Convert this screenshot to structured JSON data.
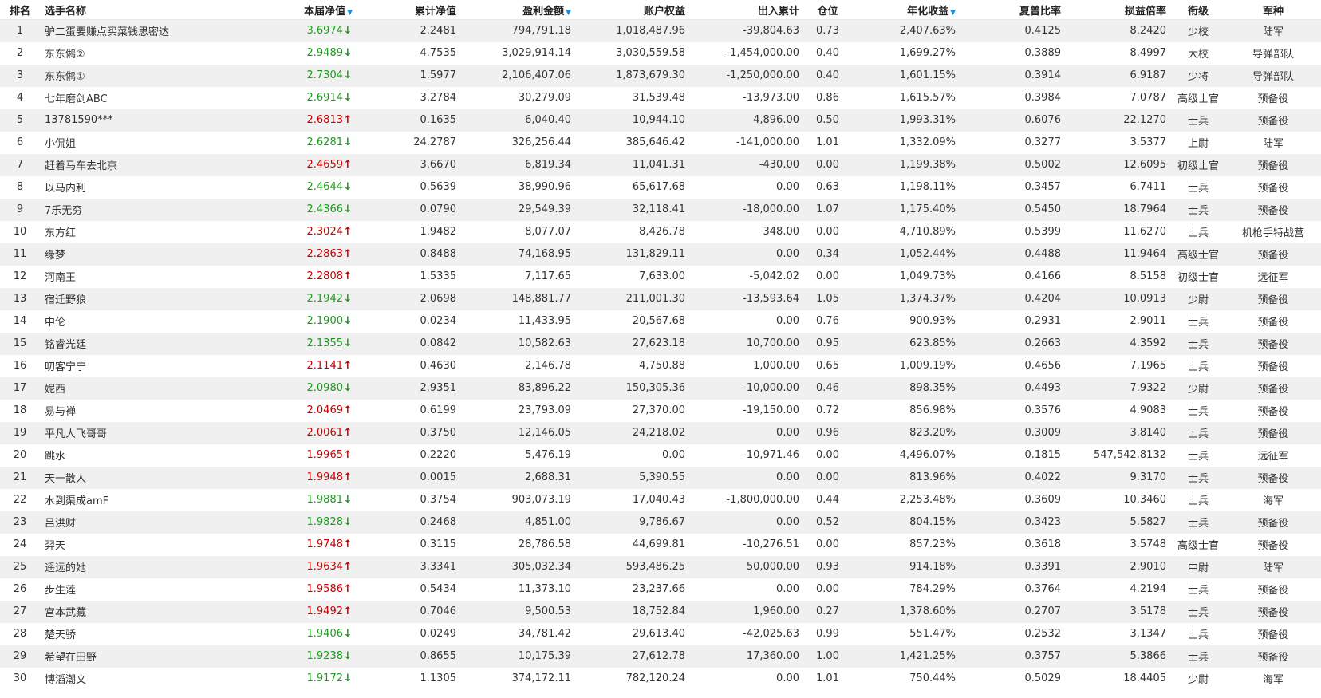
{
  "header": {
    "rank": "排名",
    "name": "选手名称",
    "nav": "本届净值",
    "cum_nav": "累计净值",
    "profit": "盈利金额",
    "equity": "账户权益",
    "flow": "出入累计",
    "position": "仓位",
    "annual": "年化收益",
    "sharpe": "夏普比率",
    "pl_ratio": "损益倍率",
    "rank_title": "衔级",
    "branch": "军种",
    "sort_icon": "▼"
  },
  "colors": {
    "up": "#cc0000",
    "down": "#1a9e1a",
    "sort": "#1a8fd8",
    "stripe": "#f0f0f0"
  },
  "rows": [
    {
      "rank": "1",
      "name": "驴二蛋要赚点买菜钱思密达",
      "nav": "3.6974",
      "dir": "down",
      "cum": "2.2481",
      "profit": "794,791.18",
      "equity": "1,018,487.96",
      "flow": "-39,804.63",
      "pos": "0.73",
      "annual": "2,407.63%",
      "sharpe": "0.4125",
      "plr": "8.2420",
      "title": "少校",
      "branch": "陆军"
    },
    {
      "rank": "2",
      "name": "东东鸺②",
      "nav": "2.9489",
      "dir": "down",
      "cum": "4.7535",
      "profit": "3,029,914.14",
      "equity": "3,030,559.58",
      "flow": "-1,454,000.00",
      "pos": "0.40",
      "annual": "1,699.27%",
      "sharpe": "0.3889",
      "plr": "8.4997",
      "title": "大校",
      "branch": "导弹部队"
    },
    {
      "rank": "3",
      "name": "东东鸺①",
      "nav": "2.7304",
      "dir": "down",
      "cum": "1.5977",
      "profit": "2,106,407.06",
      "equity": "1,873,679.30",
      "flow": "-1,250,000.00",
      "pos": "0.40",
      "annual": "1,601.15%",
      "sharpe": "0.3914",
      "plr": "6.9187",
      "title": "少将",
      "branch": "导弹部队"
    },
    {
      "rank": "4",
      "name": "七年磨剑ABC",
      "nav": "2.6914",
      "dir": "down",
      "cum": "3.2784",
      "profit": "30,279.09",
      "equity": "31,539.48",
      "flow": "-13,973.00",
      "pos": "0.86",
      "annual": "1,615.57%",
      "sharpe": "0.3984",
      "plr": "7.0787",
      "title": "高级士官",
      "branch": "预备役"
    },
    {
      "rank": "5",
      "name": "13781590***",
      "nav": "2.6813",
      "dir": "up",
      "cum": "0.1635",
      "profit": "6,040.40",
      "equity": "10,944.10",
      "flow": "4,896.00",
      "pos": "0.50",
      "annual": "1,993.31%",
      "sharpe": "0.6076",
      "plr": "22.1270",
      "title": "士兵",
      "branch": "预备役"
    },
    {
      "rank": "6",
      "name": "小侃姐",
      "nav": "2.6281",
      "dir": "down",
      "cum": "24.2787",
      "profit": "326,256.44",
      "equity": "385,646.42",
      "flow": "-141,000.00",
      "pos": "1.01",
      "annual": "1,332.09%",
      "sharpe": "0.3277",
      "plr": "3.5377",
      "title": "上尉",
      "branch": "陆军"
    },
    {
      "rank": "7",
      "name": "赶着马车去北京",
      "nav": "2.4659",
      "dir": "up",
      "cum": "3.6670",
      "profit": "6,819.34",
      "equity": "11,041.31",
      "flow": "-430.00",
      "pos": "0.00",
      "annual": "1,199.38%",
      "sharpe": "0.5002",
      "plr": "12.6095",
      "title": "初级士官",
      "branch": "预备役"
    },
    {
      "rank": "8",
      "name": "以马内利",
      "nav": "2.4644",
      "dir": "down",
      "cum": "0.5639",
      "profit": "38,990.96",
      "equity": "65,617.68",
      "flow": "0.00",
      "pos": "0.63",
      "annual": "1,198.11%",
      "sharpe": "0.3457",
      "plr": "6.7411",
      "title": "士兵",
      "branch": "预备役"
    },
    {
      "rank": "9",
      "name": "7乐无穷",
      "nav": "2.4366",
      "dir": "down",
      "cum": "0.0790",
      "profit": "29,549.39",
      "equity": "32,118.41",
      "flow": "-18,000.00",
      "pos": "1.07",
      "annual": "1,175.40%",
      "sharpe": "0.5450",
      "plr": "18.7964",
      "title": "士兵",
      "branch": "预备役"
    },
    {
      "rank": "10",
      "name": "东方红",
      "nav": "2.3024",
      "dir": "up",
      "cum": "1.9482",
      "profit": "8,077.07",
      "equity": "8,426.78",
      "flow": "348.00",
      "pos": "0.00",
      "annual": "4,710.89%",
      "sharpe": "0.5399",
      "plr": "11.6270",
      "title": "士兵",
      "branch": "机枪手特战营"
    },
    {
      "rank": "11",
      "name": "缘梦",
      "nav": "2.2863",
      "dir": "up",
      "cum": "0.8488",
      "profit": "74,168.95",
      "equity": "131,829.11",
      "flow": "0.00",
      "pos": "0.34",
      "annual": "1,052.44%",
      "sharpe": "0.4488",
      "plr": "11.9464",
      "title": "高级士官",
      "branch": "预备役"
    },
    {
      "rank": "12",
      "name": "河南王",
      "nav": "2.2808",
      "dir": "up",
      "cum": "1.5335",
      "profit": "7,117.65",
      "equity": "7,633.00",
      "flow": "-5,042.02",
      "pos": "0.00",
      "annual": "1,049.73%",
      "sharpe": "0.4166",
      "plr": "8.5158",
      "title": "初级士官",
      "branch": "远征军"
    },
    {
      "rank": "13",
      "name": "宿迁野狼",
      "nav": "2.1942",
      "dir": "down",
      "cum": "2.0698",
      "profit": "148,881.77",
      "equity": "211,001.30",
      "flow": "-13,593.64",
      "pos": "1.05",
      "annual": "1,374.37%",
      "sharpe": "0.4204",
      "plr": "10.0913",
      "title": "少尉",
      "branch": "预备役"
    },
    {
      "rank": "14",
      "name": "中伦",
      "nav": "2.1900",
      "dir": "down",
      "cum": "0.0234",
      "profit": "11,433.95",
      "equity": "20,567.68",
      "flow": "0.00",
      "pos": "0.76",
      "annual": "900.93%",
      "sharpe": "0.2931",
      "plr": "2.9011",
      "title": "士兵",
      "branch": "预备役"
    },
    {
      "rank": "15",
      "name": "铭睿光廷",
      "nav": "2.1355",
      "dir": "down",
      "cum": "0.0842",
      "profit": "10,582.63",
      "equity": "27,623.18",
      "flow": "10,700.00",
      "pos": "0.95",
      "annual": "623.85%",
      "sharpe": "0.2663",
      "plr": "4.3592",
      "title": "士兵",
      "branch": "预备役"
    },
    {
      "rank": "16",
      "name": "叨客宁宁",
      "nav": "2.1141",
      "dir": "up",
      "cum": "0.4630",
      "profit": "2,146.78",
      "equity": "4,750.88",
      "flow": "1,000.00",
      "pos": "0.65",
      "annual": "1,009.19%",
      "sharpe": "0.4656",
      "plr": "7.1965",
      "title": "士兵",
      "branch": "预备役"
    },
    {
      "rank": "17",
      "name": "妮西",
      "nav": "2.0980",
      "dir": "down",
      "cum": "2.9351",
      "profit": "83,896.22",
      "equity": "150,305.36",
      "flow": "-10,000.00",
      "pos": "0.46",
      "annual": "898.35%",
      "sharpe": "0.4493",
      "plr": "7.9322",
      "title": "少尉",
      "branch": "预备役"
    },
    {
      "rank": "18",
      "name": "易与禅",
      "nav": "2.0469",
      "dir": "up",
      "cum": "0.6199",
      "profit": "23,793.09",
      "equity": "27,370.00",
      "flow": "-19,150.00",
      "pos": "0.72",
      "annual": "856.98%",
      "sharpe": "0.3576",
      "plr": "4.9083",
      "title": "士兵",
      "branch": "预备役"
    },
    {
      "rank": "19",
      "name": "平凡人飞哥哥",
      "nav": "2.0061",
      "dir": "up",
      "cum": "0.3750",
      "profit": "12,146.05",
      "equity": "24,218.02",
      "flow": "0.00",
      "pos": "0.96",
      "annual": "823.20%",
      "sharpe": "0.3009",
      "plr": "3.8140",
      "title": "士兵",
      "branch": "预备役"
    },
    {
      "rank": "20",
      "name": "跳水",
      "nav": "1.9965",
      "dir": "up",
      "cum": "0.2220",
      "profit": "5,476.19",
      "equity": "0.00",
      "flow": "-10,971.46",
      "pos": "0.00",
      "annual": "4,496.07%",
      "sharpe": "0.1815",
      "plr": "547,542.8132",
      "title": "士兵",
      "branch": "远征军"
    },
    {
      "rank": "21",
      "name": "天一散人",
      "nav": "1.9948",
      "dir": "up",
      "cum": "0.0015",
      "profit": "2,688.31",
      "equity": "5,390.55",
      "flow": "0.00",
      "pos": "0.00",
      "annual": "813.96%",
      "sharpe": "0.4022",
      "plr": "9.3170",
      "title": "士兵",
      "branch": "预备役"
    },
    {
      "rank": "22",
      "name": "水到渠成amF",
      "nav": "1.9881",
      "dir": "down",
      "cum": "0.3754",
      "profit": "903,073.19",
      "equity": "17,040.43",
      "flow": "-1,800,000.00",
      "pos": "0.44",
      "annual": "2,253.48%",
      "sharpe": "0.3609",
      "plr": "10.3460",
      "title": "士兵",
      "branch": "海军"
    },
    {
      "rank": "23",
      "name": "吕洪财",
      "nav": "1.9828",
      "dir": "down",
      "cum": "0.2468",
      "profit": "4,851.00",
      "equity": "9,786.67",
      "flow": "0.00",
      "pos": "0.52",
      "annual": "804.15%",
      "sharpe": "0.3423",
      "plr": "5.5827",
      "title": "士兵",
      "branch": "预备役"
    },
    {
      "rank": "24",
      "name": "羿天",
      "nav": "1.9748",
      "dir": "up",
      "cum": "0.3115",
      "profit": "28,786.58",
      "equity": "44,699.81",
      "flow": "-10,276.51",
      "pos": "0.00",
      "annual": "857.23%",
      "sharpe": "0.3618",
      "plr": "3.5748",
      "title": "高级士官",
      "branch": "预备役"
    },
    {
      "rank": "25",
      "name": "遥远的她",
      "nav": "1.9634",
      "dir": "up",
      "cum": "3.3341",
      "profit": "305,032.34",
      "equity": "593,486.25",
      "flow": "50,000.00",
      "pos": "0.93",
      "annual": "914.18%",
      "sharpe": "0.3391",
      "plr": "2.9010",
      "title": "中尉",
      "branch": "陆军"
    },
    {
      "rank": "26",
      "name": "步生莲",
      "nav": "1.9586",
      "dir": "up",
      "cum": "0.5434",
      "profit": "11,373.10",
      "equity": "23,237.66",
      "flow": "0.00",
      "pos": "0.00",
      "annual": "784.29%",
      "sharpe": "0.3764",
      "plr": "4.2194",
      "title": "士兵",
      "branch": "预备役"
    },
    {
      "rank": "27",
      "name": "宫本武藏",
      "nav": "1.9492",
      "dir": "up",
      "cum": "0.7046",
      "profit": "9,500.53",
      "equity": "18,752.84",
      "flow": "1,960.00",
      "pos": "0.27",
      "annual": "1,378.60%",
      "sharpe": "0.2707",
      "plr": "3.5178",
      "title": "士兵",
      "branch": "预备役"
    },
    {
      "rank": "28",
      "name": "楚天骄",
      "nav": "1.9406",
      "dir": "down",
      "cum": "0.0249",
      "profit": "34,781.42",
      "equity": "29,613.40",
      "flow": "-42,025.63",
      "pos": "0.99",
      "annual": "551.47%",
      "sharpe": "0.2532",
      "plr": "3.1347",
      "title": "士兵",
      "branch": "预备役"
    },
    {
      "rank": "29",
      "name": "希望在田野",
      "nav": "1.9238",
      "dir": "down",
      "cum": "0.8655",
      "profit": "10,175.39",
      "equity": "27,612.78",
      "flow": "17,360.00",
      "pos": "1.00",
      "annual": "1,421.25%",
      "sharpe": "0.3757",
      "plr": "5.3866",
      "title": "士兵",
      "branch": "预备役"
    },
    {
      "rank": "30",
      "name": "博滔潮文",
      "nav": "1.9172",
      "dir": "down",
      "cum": "1.1305",
      "profit": "374,172.11",
      "equity": "782,120.24",
      "flow": "0.00",
      "pos": "1.01",
      "annual": "750.44%",
      "sharpe": "0.5029",
      "plr": "18.4405",
      "title": "少尉",
      "branch": "海军"
    }
  ]
}
